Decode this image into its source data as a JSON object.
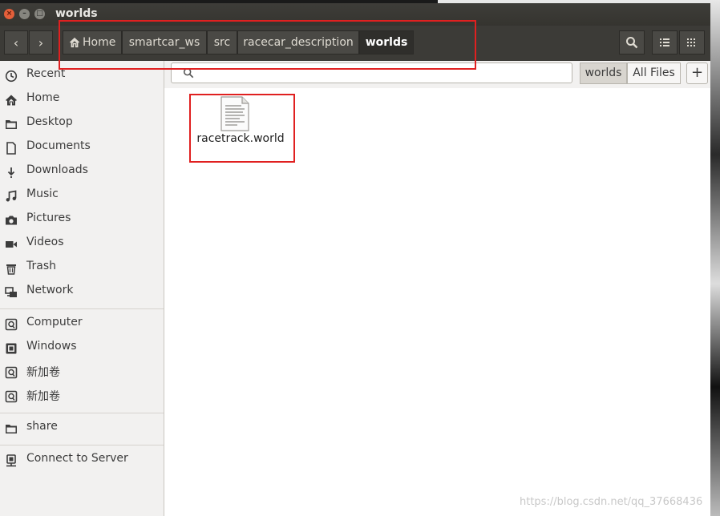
{
  "window": {
    "title": "worlds"
  },
  "titlebar": {
    "close_glyph": "×",
    "minimize_glyph": "–",
    "maximize_glyph": "□"
  },
  "toolbar": {
    "back_glyph": "‹",
    "forward_glyph": "›",
    "breadcrumbs": [
      {
        "label": "Home",
        "active": false
      },
      {
        "label": "smartcar_ws",
        "active": false
      },
      {
        "label": "src",
        "active": false
      },
      {
        "label": "racecar_description",
        "active": false
      },
      {
        "label": "worlds",
        "active": true
      }
    ]
  },
  "sidebar": {
    "items": [
      {
        "label": "Recent",
        "icon": "clock-icon"
      },
      {
        "label": "Home",
        "icon": "home-icon"
      },
      {
        "label": "Desktop",
        "icon": "folder-icon"
      },
      {
        "label": "Documents",
        "icon": "document-icon"
      },
      {
        "label": "Downloads",
        "icon": "download-icon"
      },
      {
        "label": "Music",
        "icon": "music-icon"
      },
      {
        "label": "Pictures",
        "icon": "camera-icon"
      },
      {
        "label": "Videos",
        "icon": "video-icon"
      },
      {
        "label": "Trash",
        "icon": "trash-icon"
      },
      {
        "label": "Network",
        "icon": "network-icon"
      },
      {
        "label": "Computer",
        "icon": "drive-icon"
      },
      {
        "label": "Windows",
        "icon": "chip-icon"
      },
      {
        "label": "新加卷",
        "icon": "drive-icon"
      },
      {
        "label": "新加卷",
        "icon": "drive-icon"
      },
      {
        "label": "share",
        "icon": "folder-icon"
      },
      {
        "label": "Connect to Server",
        "icon": "server-icon"
      }
    ]
  },
  "search": {
    "value": "",
    "filters": [
      {
        "label": "worlds",
        "active": true
      },
      {
        "label": "All Files",
        "active": false
      }
    ],
    "add_glyph": "+"
  },
  "files": [
    {
      "name": "racetrack.world",
      "icon": "text-file-icon"
    }
  ],
  "watermark": {
    "text": "https://blog.csdn.net/qq_37668436"
  },
  "colors": {
    "toolbar_bg": "#3c3b37",
    "close_button": "#e45f3a",
    "annotation_red": "#e02020"
  }
}
